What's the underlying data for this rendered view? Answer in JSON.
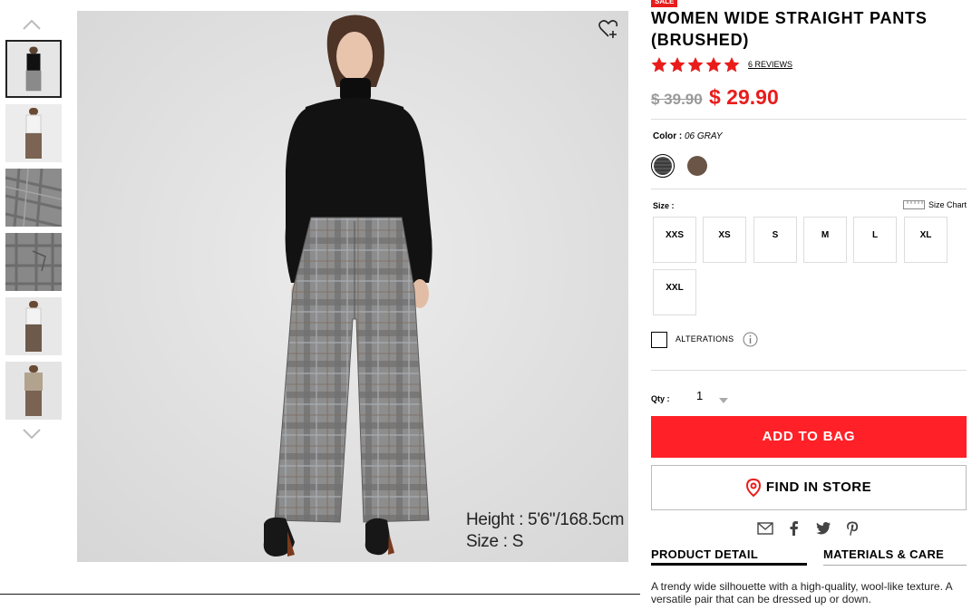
{
  "product": {
    "badge": "SALE",
    "title": "WOMEN WIDE STRAIGHT PANTS (BRUSHED)",
    "rating": 5,
    "reviews": "6 REVIEWS",
    "price_original": "$ 39.90",
    "price_sale": "$ 29.90"
  },
  "color": {
    "label": "Color :",
    "value": "06 GRAY",
    "swatches": [
      {
        "name": "gray-check",
        "hex": "#8a8a8a",
        "selected": true
      },
      {
        "name": "brown",
        "hex": "#6a5547",
        "selected": false
      }
    ]
  },
  "size": {
    "label": "Size :",
    "chart_label": "Size Chart",
    "options": [
      "XXS",
      "XS",
      "S",
      "M",
      "L",
      "XL",
      "XXL"
    ]
  },
  "alterations": {
    "label": "ALTERATIONS"
  },
  "quantity": {
    "label": "Qty :",
    "value": "1"
  },
  "actions": {
    "add_to_bag": "ADD TO BAG",
    "find_in_store": "FIND IN STORE"
  },
  "tabs": [
    {
      "label": "PRODUCT DETAIL",
      "active": true
    },
    {
      "label": "MATERIALS & CARE",
      "active": false
    }
  ],
  "description": "A trendy wide silhouette with a high-quality, wool-like texture. A versatile pair that can be dressed up or down.",
  "image_caption": {
    "height": "Height : 5'6\"/168.5cm",
    "size": "Size : S"
  },
  "colors": {
    "accent": "#ff2127",
    "sale_red": "#e91c1c",
    "star": "#e91c1c"
  }
}
